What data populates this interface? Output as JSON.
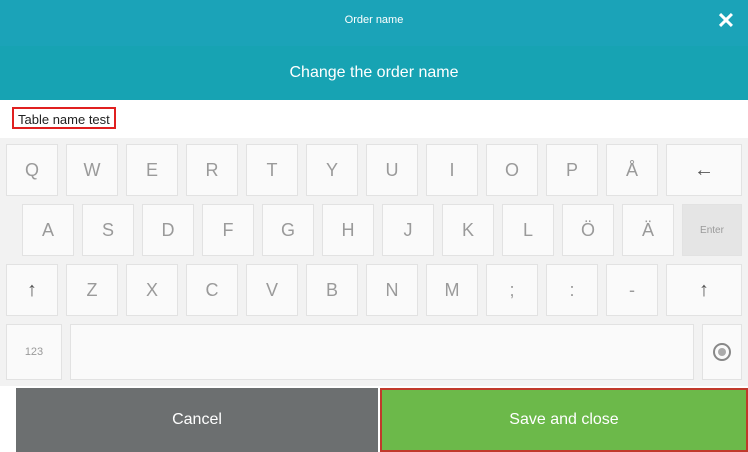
{
  "window": {
    "title": "Order name",
    "close_glyph": "✕"
  },
  "header": {
    "subtitle": "Change the order name"
  },
  "input": {
    "value": "Table name test"
  },
  "keyboard": {
    "row1": [
      "Q",
      "W",
      "E",
      "R",
      "T",
      "Y",
      "U",
      "I",
      "O",
      "P",
      "Å",
      "←"
    ],
    "row2": [
      "A",
      "S",
      "D",
      "F",
      "G",
      "H",
      "J",
      "K",
      "L",
      "Ö",
      "Ä",
      "Enter"
    ],
    "row3": [
      "↑",
      "Z",
      "X",
      "C",
      "V",
      "B",
      "N",
      "M",
      ";",
      ":",
      "-",
      "↑"
    ],
    "row4": {
      "numbers": "123",
      "settings_icon": "circle-icon"
    }
  },
  "footer": {
    "cancel_label": "Cancel",
    "save_label": "Save and close"
  },
  "colors": {
    "title_bg": "#1ba3b8",
    "save_bg": "#6cb94a",
    "cancel_bg": "#6c6f70",
    "highlight": "#e02020"
  }
}
